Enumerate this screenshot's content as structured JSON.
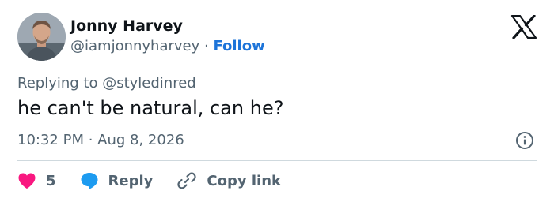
{
  "user": {
    "name": "Jonny Harvey",
    "handle": "@iamjonnyharvey",
    "separator": "·",
    "follow_label": "Follow"
  },
  "tweet": {
    "replying_to": "Replying to @styledinred",
    "text": "he can't be natural, can he?",
    "time": "10:32 PM",
    "separator": "·",
    "date": "Aug 8, 2026"
  },
  "actions": {
    "like_count": "5",
    "reply_label": "Reply",
    "copy_label": "Copy link"
  },
  "icons": {
    "logo": "x-logo-icon",
    "info": "info-icon",
    "like": "heart-icon",
    "reply": "speech-bubble-icon",
    "copy": "link-icon"
  },
  "colors": {
    "text": "#0f1419",
    "muted": "#536471",
    "follow": "#1d74d9",
    "heart": "#f91880",
    "reply_bubble": "#1d9bf0",
    "divider": "#cfd9de"
  }
}
